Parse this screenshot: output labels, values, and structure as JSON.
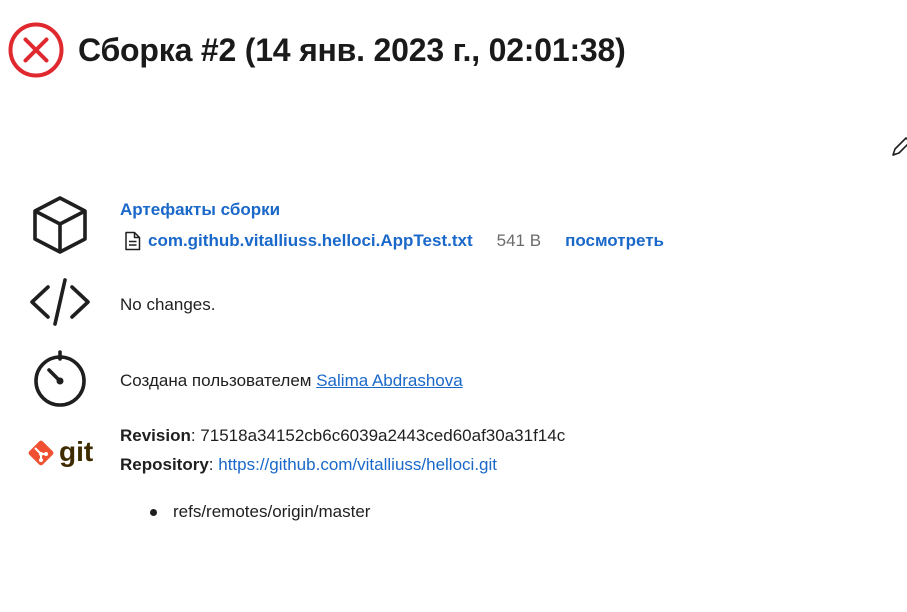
{
  "build": {
    "title": "Сборка #2 (14 янв. 2023 г., 02:01:38)",
    "status_color": "#e0282f"
  },
  "artifacts": {
    "title": "Артефакты сборки",
    "items": [
      {
        "name": "com.github.vitalliuss.helloci.AppTest.txt",
        "size": "541 B",
        "view_label": "посмотреть"
      }
    ]
  },
  "changes": {
    "text": "No changes."
  },
  "cause": {
    "prefix": "Создана пользователем ",
    "user": "Salima Abdrashova"
  },
  "git": {
    "logo_text": "git",
    "revision_label": "Revision",
    "revision_value": ": 71518a34152cb6c6039a2443ced60af30a31f14c",
    "repository_label": "Repository",
    "repository_separator": ": ",
    "repository_url": "https://github.com/vitalliuss/helloci.git",
    "branches": [
      "refs/remotes/origin/master"
    ]
  },
  "colors": {
    "link": "#1a68c9",
    "git_orange": "#f05133",
    "git_text": "#3e2c00"
  }
}
